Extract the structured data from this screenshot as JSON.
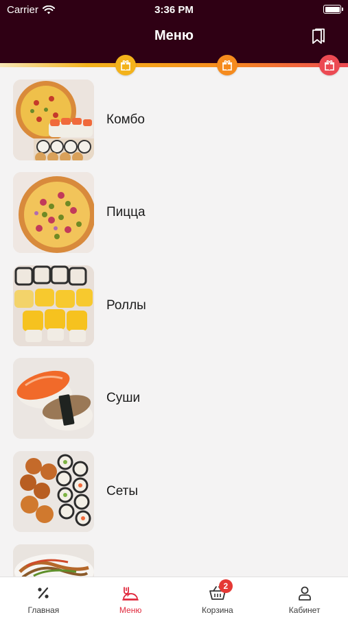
{
  "status_bar": {
    "carrier": "Carrier",
    "time": "3:36 PM"
  },
  "header": {
    "title": "Меню",
    "bookmark_icon": "bookmark-icon"
  },
  "loyalty_progress": {
    "colors": {
      "track_start": "#f3b21b",
      "track_end": "#ec4a53"
    },
    "markers": [
      {
        "icon": "gift-icon",
        "color": "#f3b21b"
      },
      {
        "icon": "gift-icon",
        "color": "#f58b1e"
      },
      {
        "icon": "gift-icon",
        "color": "#ec4a53"
      }
    ]
  },
  "menu": {
    "categories": [
      {
        "label": "Комбо",
        "image": "combo-photo"
      },
      {
        "label": "Пицца",
        "image": "pizza-photo"
      },
      {
        "label": "Роллы",
        "image": "rolls-photo"
      },
      {
        "label": "Суши",
        "image": "sushi-photo"
      },
      {
        "label": "Сеты",
        "image": "sets-photo"
      },
      {
        "label": "",
        "image": "wok-photo"
      }
    ]
  },
  "tab_bar": {
    "tabs": [
      {
        "label": "Главная",
        "icon": "percent-icon"
      },
      {
        "label": "Меню",
        "icon": "menu-dish-icon",
        "active": true
      },
      {
        "label": "Корзина",
        "icon": "basket-icon",
        "badge": "2"
      },
      {
        "label": "Кабинет",
        "icon": "user-icon"
      }
    ]
  },
  "colors": {
    "brand_dark": "#2f0014",
    "accent": "#e0283c",
    "background": "#f4f3f3"
  }
}
